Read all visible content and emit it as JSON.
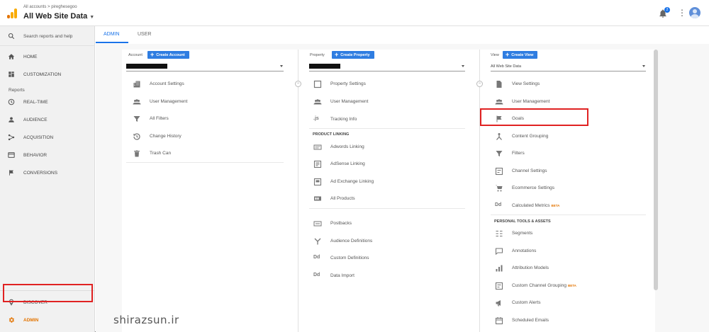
{
  "header": {
    "breadcrumb": "All accounts > pireghesegoo",
    "property_title": "All Web Site Data",
    "notification_count": "2"
  },
  "sidebar": {
    "search_placeholder": "Search reports and help",
    "home": "HOME",
    "customization": "CUSTOMIZATION",
    "reports_label": "Reports",
    "realtime": "REAL-TIME",
    "audience": "AUDIENCE",
    "acquisition": "ACQUISITION",
    "behavior": "BEHAVIOR",
    "conversions": "CONVERSIONS",
    "discover": "DISCOVER",
    "admin": "ADMIN"
  },
  "tabs": {
    "admin": "ADMIN",
    "user": "USER"
  },
  "account": {
    "label": "Account",
    "create": "Create Account",
    "items": [
      "Account Settings",
      "User Management",
      "All Filters",
      "Change History",
      "Trash Can"
    ]
  },
  "property": {
    "label": "Property",
    "create": "Create Property",
    "items": [
      "Property Settings",
      "User Management",
      "Tracking Info"
    ],
    "product_linking_label": "PRODUCT LINKING",
    "linking_items": [
      "Adwords Linking",
      "AdSense Linking",
      "Ad Exchange Linking",
      "All Products"
    ],
    "other_items": [
      "Postbacks",
      "Audience Definitions",
      "Custom Definitions",
      "Data Import"
    ]
  },
  "view": {
    "label": "View",
    "create": "Create View",
    "selected": "All Web Site Data",
    "items": [
      "View Settings",
      "User Management",
      "Goals",
      "Content Grouping",
      "Filters",
      "Channel Settings",
      "Ecommerce Settings",
      "Calculated Metrics"
    ],
    "beta": "BETA",
    "personal_label": "PERSONAL TOOLS & ASSETS",
    "personal_items": [
      "Segments",
      "Annotations",
      "Attribution Models",
      "Custom Channel Grouping",
      "Custom Alerts",
      "Scheduled Emails"
    ]
  },
  "watermark": "shirazsun.ir",
  "colors": {
    "accent": "#1a73e8",
    "admin_orange": "#e37400",
    "highlight": "#e02222"
  }
}
